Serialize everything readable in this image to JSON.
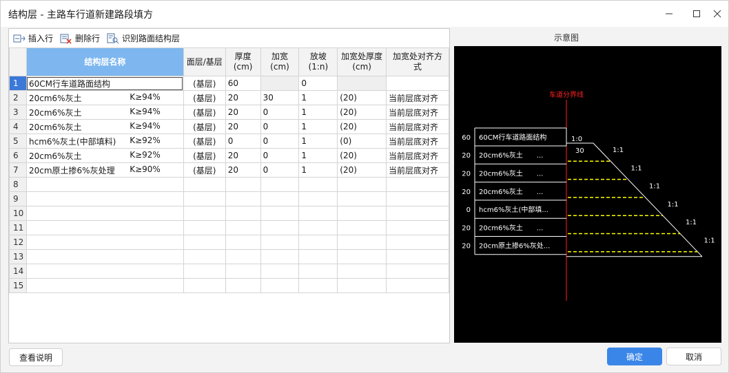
{
  "window": {
    "title": "结构层 - 主路车行道新建路段填方"
  },
  "toolbar": {
    "insert_label": "插入行",
    "delete_label": "删除行",
    "recognize_label": "识别路面结构层"
  },
  "table": {
    "headers": {
      "name": "结构层名称",
      "type": "面层/基层",
      "thickness": "厚度\n(cm)",
      "widen": "加宽\n(cm)",
      "slope": "放坡\n(1:n)",
      "widen_thickness": "加宽处厚度\n(cm)",
      "align": "加宽处对齐方式"
    },
    "rows": [
      {
        "n": "1",
        "name": "60CM行车道路面结构",
        "k": "",
        "type": "(基层)",
        "thickness": "60",
        "widen": "",
        "slope": "0",
        "widen_thickness": "",
        "align": ""
      },
      {
        "n": "2",
        "name": "20cm6%灰土",
        "k": "K≥94%",
        "type": "(基层)",
        "thickness": "20",
        "widen": "30",
        "slope": "1",
        "widen_thickness": "(20)",
        "align": "当前层底对齐"
      },
      {
        "n": "3",
        "name": "20cm6%灰土",
        "k": "K≥94%",
        "type": "(基层)",
        "thickness": "20",
        "widen": "0",
        "slope": "1",
        "widen_thickness": "(20)",
        "align": "当前层底对齐"
      },
      {
        "n": "4",
        "name": "20cm6%灰土",
        "k": "K≥94%",
        "type": "(基层)",
        "thickness": "20",
        "widen": "0",
        "slope": "1",
        "widen_thickness": "(20)",
        "align": "当前层底对齐"
      },
      {
        "n": "5",
        "name": "hcm6%灰土(中部填料)",
        "k": "K≥92%",
        "type": "(基层)",
        "thickness": "0",
        "widen": "0",
        "slope": "1",
        "widen_thickness": "(0)",
        "align": "当前层底对齐"
      },
      {
        "n": "6",
        "name": "20cm6%灰土",
        "k": "K≥92%",
        "type": "(基层)",
        "thickness": "20",
        "widen": "0",
        "slope": "1",
        "widen_thickness": "(20)",
        "align": "当前层底对齐"
      },
      {
        "n": "7",
        "name": "20cm原土掺6%灰处理",
        "k": "K≥90%",
        "type": "(基层)",
        "thickness": "20",
        "widen": "0",
        "slope": "1",
        "widen_thickness": "(20)",
        "align": "当前层底对齐"
      }
    ],
    "empty_rows": [
      "8",
      "9",
      "10",
      "11",
      "12",
      "13",
      "14",
      "15"
    ]
  },
  "preview": {
    "title": "示意图",
    "divider_label": "车道分界线",
    "layers": [
      {
        "thickness": "60",
        "name": "60CM行车道路面结构",
        "slope": "1:0"
      },
      {
        "thickness": "20",
        "name": "20cm6%灰土　　...",
        "slope": "1:1"
      },
      {
        "thickness": "20",
        "name": "20cm6%灰土　　...",
        "slope": "1:1"
      },
      {
        "thickness": "20",
        "name": "20cm6%灰土　　...",
        "slope": "1:1"
      },
      {
        "thickness": "0",
        "name": "hcm6%灰土(中部填...",
        "slope": "1:1"
      },
      {
        "thickness": "20",
        "name": "20cm6%灰土　　...",
        "slope": "1:1"
      },
      {
        "thickness": "20",
        "name": "20cm原土掺6%灰处...",
        "slope": "1:1"
      }
    ],
    "widen_label": "30",
    "colors": {
      "background": "#000000",
      "lines": "#ffffff",
      "divider": "#ff2020",
      "dashes": "#ffff00"
    }
  },
  "buttons": {
    "help": "查看说明",
    "ok": "确定",
    "cancel": "取消"
  }
}
